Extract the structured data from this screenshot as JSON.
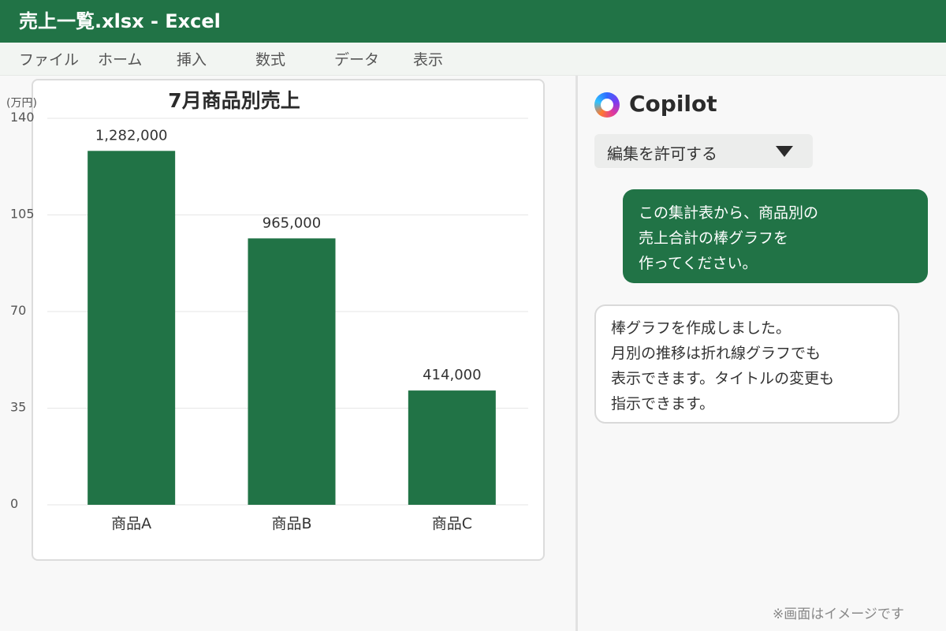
{
  "window": {
    "title": "売上一覧.xlsx - Excel"
  },
  "ribbon": {
    "tabs": [
      "ファイル",
      "ホーム",
      "挿入",
      "数式",
      "データ",
      "表示"
    ]
  },
  "colors": {
    "accent": "#217346",
    "bar": "#217346"
  },
  "chart_data": {
    "type": "bar",
    "title": "7月商品別売上",
    "ylabel": "(万円)",
    "xlabel": "",
    "categories": [
      "商品A",
      "商品B",
      "商品C"
    ],
    "values": [
      128.2,
      96.5,
      41.4
    ],
    "data_labels": [
      "1,282,000",
      "965,000",
      "414,000"
    ],
    "ylim": [
      0,
      140
    ],
    "yticks": [
      0,
      35,
      70,
      105,
      140
    ],
    "grid": true,
    "legend": "none"
  },
  "copilot": {
    "title": "Copilot",
    "logo_icon": "copilot-logo-icon",
    "permission_select": "編集を許可する",
    "user_message_lines": [
      "この集計表から、商品別の",
      "売上合計の棒グラフを",
      "作ってください。"
    ],
    "assistant_message_lines": [
      "棒グラフを作成しました。",
      "月別の推移は折れ線グラフでも",
      "表示できます。タイトルの変更も",
      "指示できます。"
    ]
  },
  "footnote": "※画面はイメージです"
}
